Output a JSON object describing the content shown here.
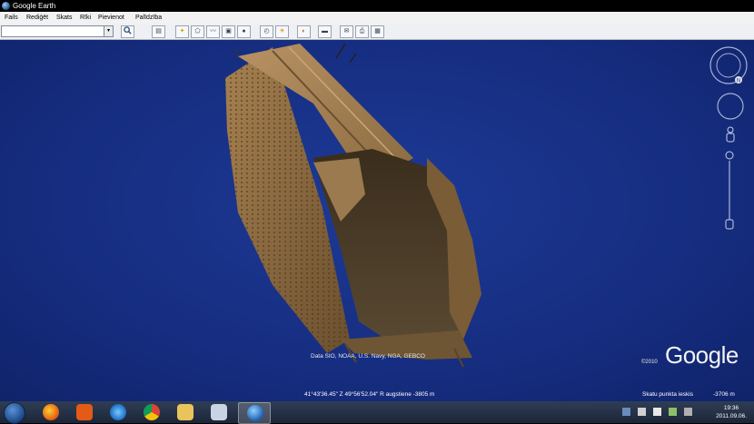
{
  "window": {
    "title": "Google Earth"
  },
  "menu": [
    "Fails",
    "Rediģēt",
    "Skats",
    "Rīki",
    "Pievienot",
    "Palīdzība"
  ],
  "search": {
    "value": "",
    "placeholder": ""
  },
  "toolbar": {
    "buttons": [
      "sidebar-toggle",
      "add-placemark",
      "add-polygon",
      "add-path",
      "add-image-overlay",
      "record-tour",
      "historical-imagery",
      "sun",
      "switch-to-sky",
      "ruler",
      "email",
      "print",
      "view-in-google-maps"
    ]
  },
  "map": {
    "attribution": "Data SIO, NOAA, U.S. Navy, NGA, GEBCO",
    "copyright": "©2010",
    "logo": "Google"
  },
  "status": {
    "coordinates": "41°43'36.45\" Z   49°56'52.04\" R  augstiene -3805 m",
    "eye_label": "Skatu punkta ieskis",
    "eye_alt": "-3706 m"
  },
  "nav": {
    "north_label": "N"
  },
  "taskbar": {
    "apps": [
      "firefox",
      "avast",
      "internet-explorer",
      "chrome",
      "file-explorer",
      "unknown-app",
      "google-earth"
    ],
    "active_app": "google-earth",
    "time": "19:36",
    "date": "2011.09.06."
  },
  "colors": {
    "ocean": "#1a3590",
    "hull": "#8a6a40"
  }
}
